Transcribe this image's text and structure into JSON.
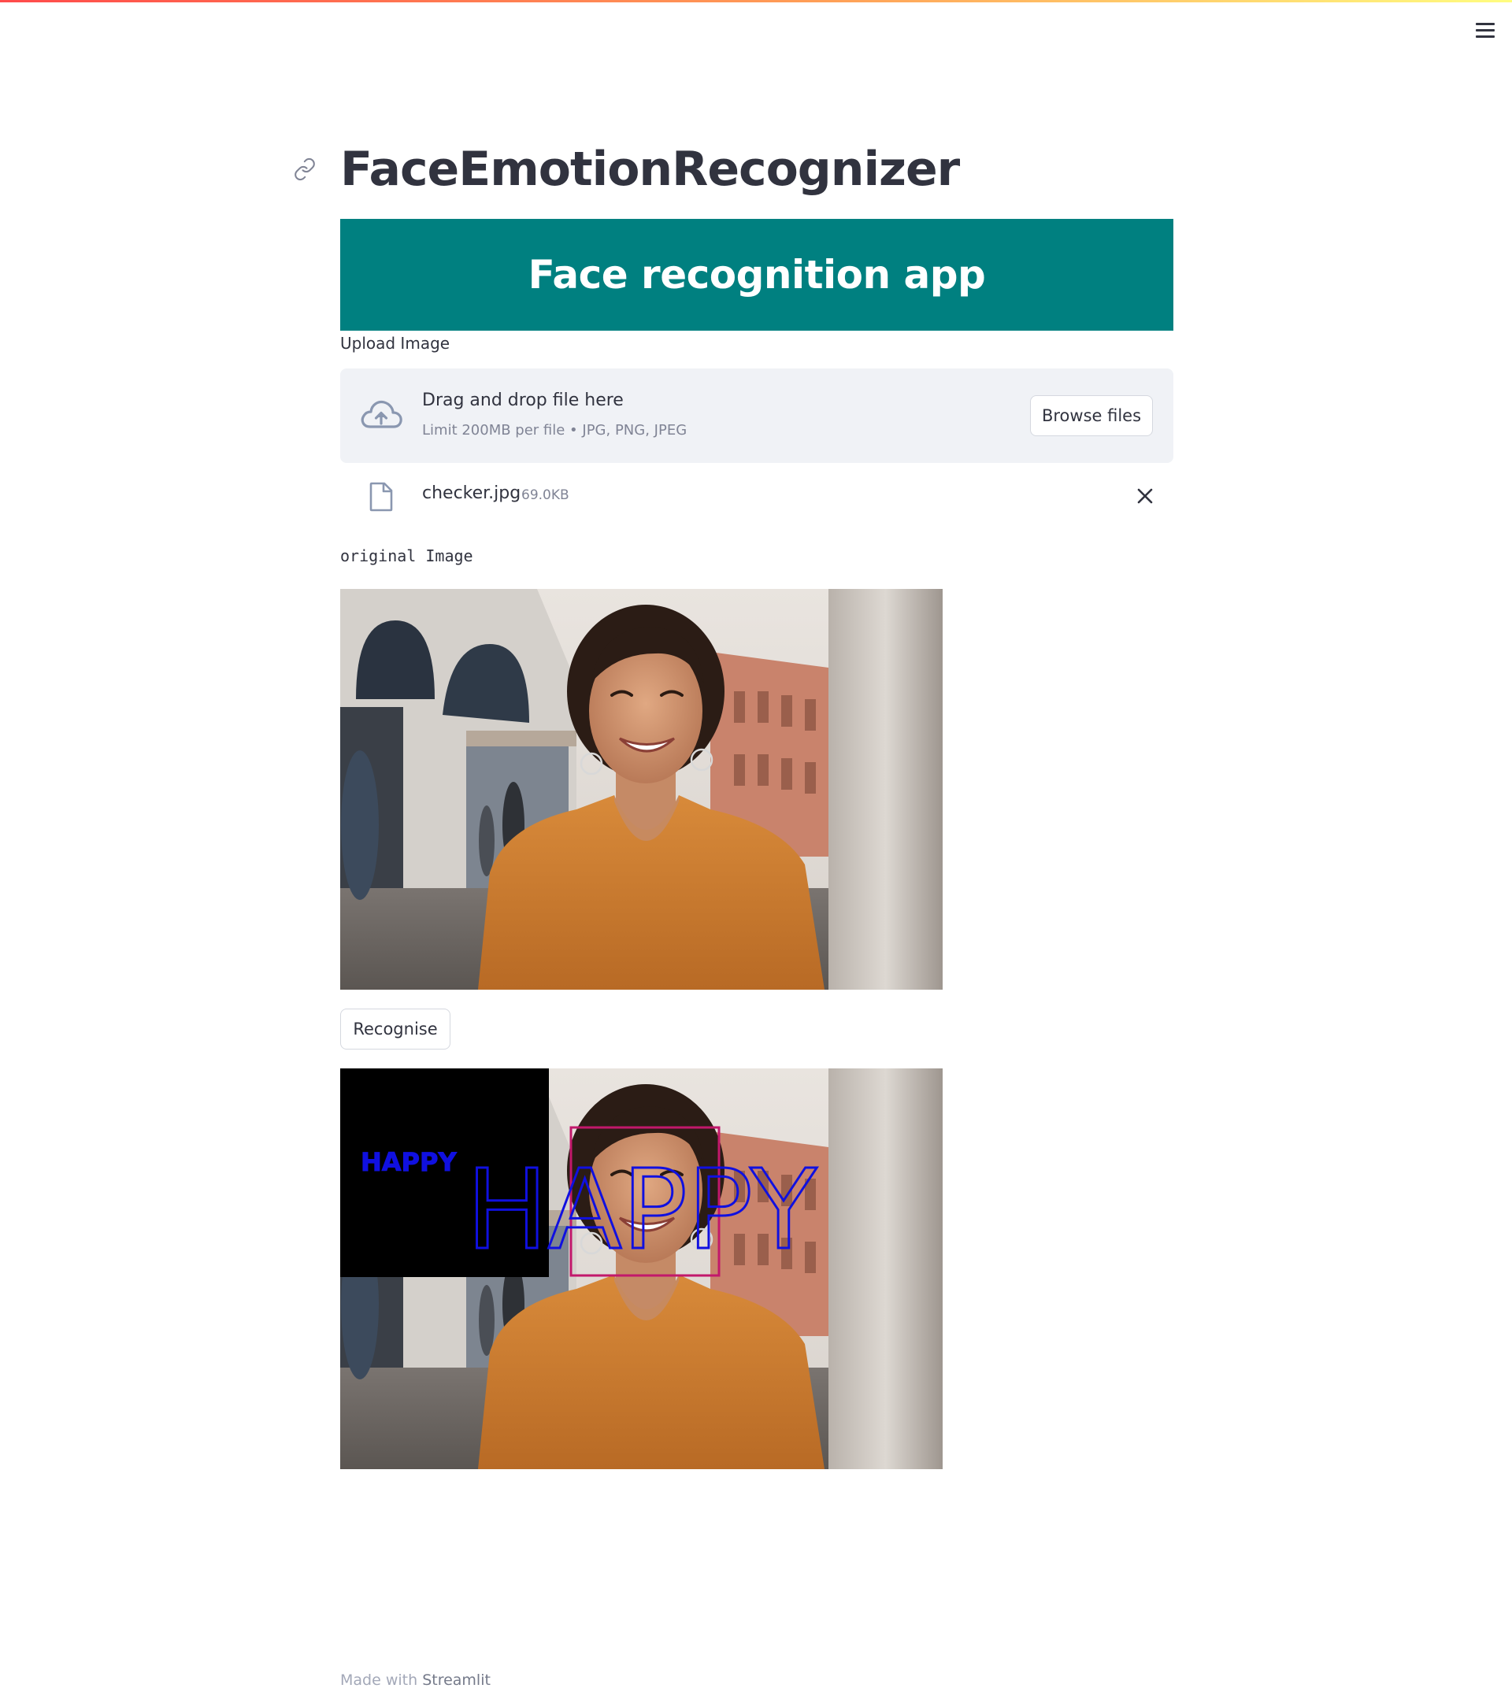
{
  "page": {
    "title": "FaceEmotionRecognizer",
    "banner_heading": "Face recognition app"
  },
  "uploader": {
    "label": "Upload Image",
    "drop_title": "Drag and drop file here",
    "drop_limits": "Limit 200MB per file • JPG, PNG, JPEG",
    "browse_label": "Browse files",
    "file": {
      "name": "checker.jpg",
      "size": "69.0KB"
    }
  },
  "original_label": "original Image",
  "recognise_label": "Recognise",
  "result": {
    "emotion_small": "HAPPY",
    "emotion_large": "HAPPY"
  },
  "footer": {
    "prefix": "Made with",
    "brand": "Streamlit"
  },
  "icons": [
    "link-icon",
    "menu-icon",
    "cloud-upload-icon",
    "file-icon",
    "close-icon"
  ],
  "colors": {
    "banner": "#008080",
    "text": "#31333f",
    "dropzone": "#f0f2f6",
    "annotation_blue": "#1010e0",
    "face_box": "#c2186b"
  }
}
